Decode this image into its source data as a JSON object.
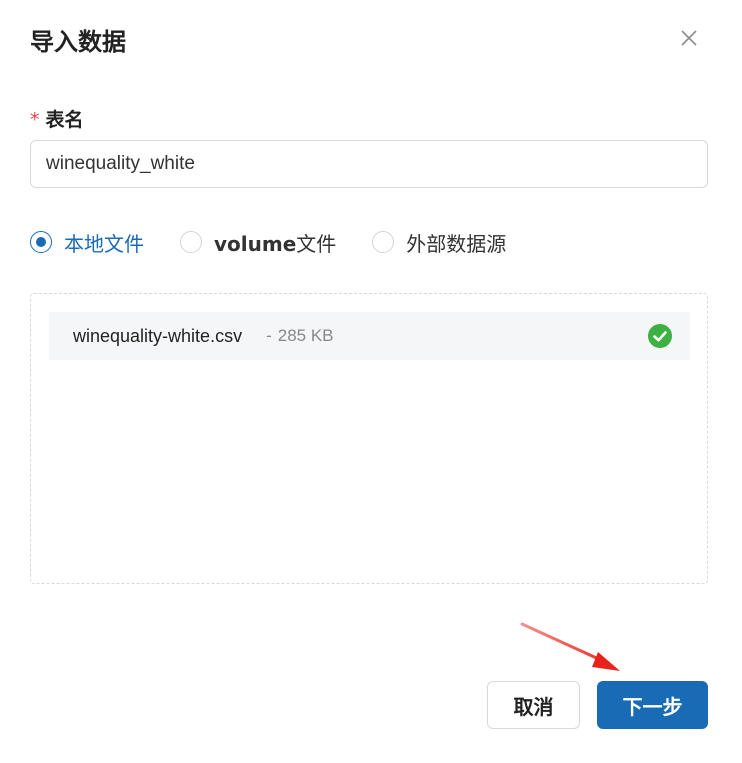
{
  "dialog": {
    "title": "导入数据",
    "close_icon": "close-icon"
  },
  "form": {
    "table_name": {
      "required_mark": "*",
      "label": "表名",
      "value": "winequality_white"
    },
    "source": {
      "options": [
        {
          "label_prefix": "",
          "label": "本地文件",
          "checked": true
        },
        {
          "label_prefix": "volume",
          "label": "文件",
          "checked": false
        },
        {
          "label_prefix": "",
          "label": "外部数据源",
          "checked": false
        }
      ]
    }
  },
  "upload": {
    "files": [
      {
        "name": "winequality-white.csv",
        "size_prefix": "-",
        "size": "285 KB",
        "status_icon": "check-circle-icon",
        "status_color": "#3cb043"
      }
    ]
  },
  "footer": {
    "cancel_label": "取消",
    "next_label": "下一步"
  },
  "colors": {
    "primary": "#1a6bb5",
    "required": "#e5484d",
    "success": "#3cb043",
    "annotation_arrow": "#e8231a"
  }
}
